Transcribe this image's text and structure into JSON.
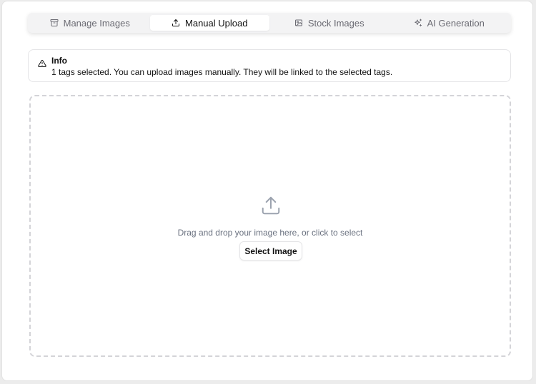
{
  "tabs": [
    {
      "label": "Manage Images",
      "icon": "archive-icon"
    },
    {
      "label": "Manual Upload",
      "icon": "upload-icon",
      "active": true
    },
    {
      "label": "Stock Images",
      "icon": "image-icon"
    },
    {
      "label": "AI Generation",
      "icon": "sparkles-icon"
    }
  ],
  "info": {
    "title": "Info",
    "message": "1 tags selected. You can upload images manually. They will be linked to the selected tags.",
    "icon": "warning-triangle-icon"
  },
  "dropzone": {
    "icon": "upload-icon",
    "text": "Drag and drop your image here, or click to select",
    "button_label": "Select Image"
  },
  "colors": {
    "tab_background": "#f3f3f4",
    "muted_text": "#6b6b73",
    "dashed_border": "#d4d4d8",
    "icon_gray": "#9ca3af"
  }
}
